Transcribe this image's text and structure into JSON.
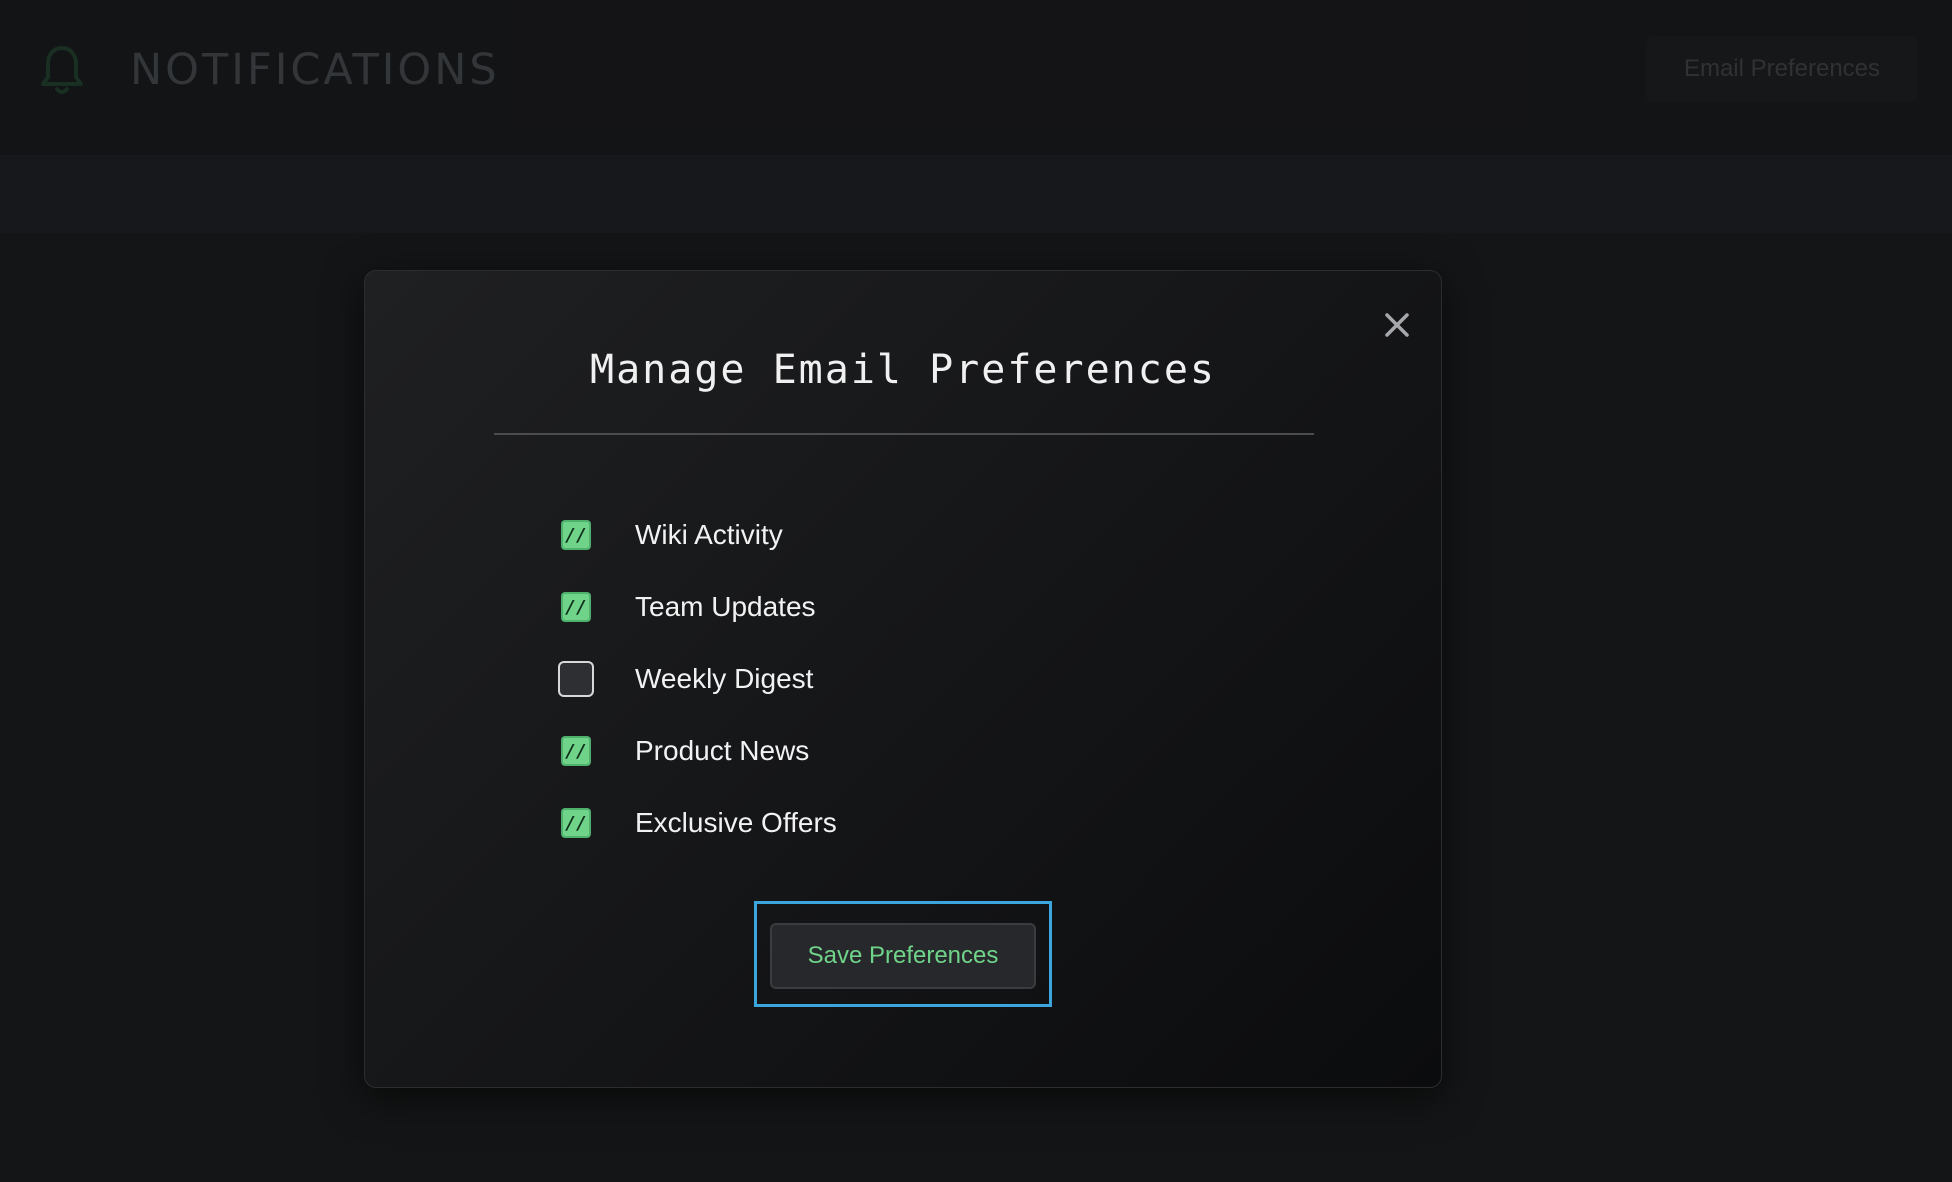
{
  "header": {
    "icon": "bell-icon",
    "title": "NOTIFICATIONS",
    "email_preferences_label": "Email Preferences"
  },
  "modal": {
    "title": "Manage Email Preferences",
    "close_icon": "close-icon",
    "options": [
      {
        "label": "Wiki Activity",
        "checked": true
      },
      {
        "label": "Team Updates",
        "checked": true
      },
      {
        "label": "Weekly Digest",
        "checked": false
      },
      {
        "label": "Product News",
        "checked": true
      },
      {
        "label": "Exclusive Offers",
        "checked": true
      }
    ],
    "checked_mark": "//",
    "save_label": "Save Preferences"
  },
  "colors": {
    "accent_green": "#6fd48a",
    "focus_blue": "#3aa6dd",
    "background": "#191a1c"
  }
}
